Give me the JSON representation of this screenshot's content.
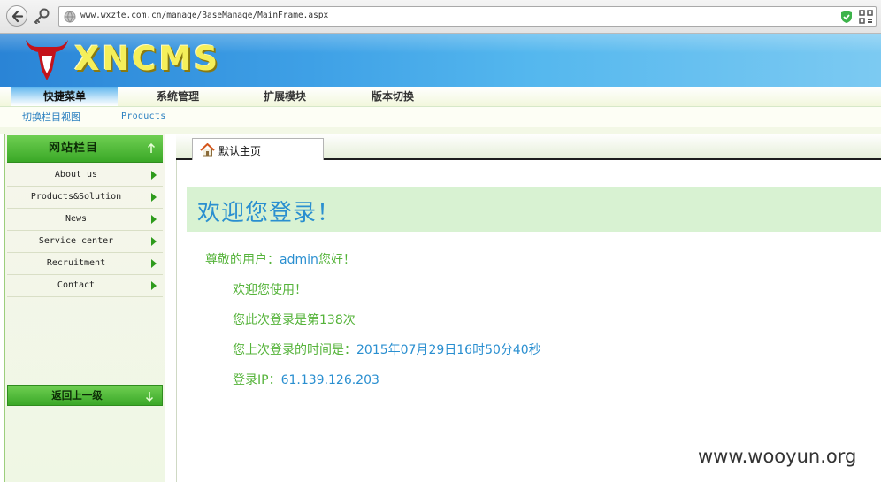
{
  "browser": {
    "url": "www.wxzte.com.cn/manage/BaseManage/MainFrame.aspx"
  },
  "header": {
    "logo_text": "XNCMS"
  },
  "menu": {
    "items": [
      {
        "label": "快捷菜单",
        "active": true
      },
      {
        "label": "系统管理",
        "active": false
      },
      {
        "label": "扩展模块",
        "active": false
      },
      {
        "label": "版本切换",
        "active": false
      }
    ],
    "sub_items": [
      "切换栏目视图",
      "Products"
    ]
  },
  "sidebar": {
    "title": "网站栏目",
    "items": [
      {
        "label": "About us"
      },
      {
        "label": "Products&Solution"
      },
      {
        "label": "News"
      },
      {
        "label": "Service center"
      },
      {
        "label": "Recruitment"
      },
      {
        "label": "Contact"
      }
    ],
    "back_label": "返回上一级"
  },
  "tab": {
    "label": "默认主页"
  },
  "content": {
    "welcome_title": "欢迎您登录！",
    "greeting_prefix": "尊敬的用户：",
    "username": "admin",
    "greeting_suffix": "您好！",
    "welcome_use": "欢迎您使用！",
    "login_count_prefix": "您此次登录是第",
    "login_count": "138",
    "login_count_suffix": "次",
    "last_login_label": "您上次登录的时间是：",
    "last_login_time": "2015年07月29日16时50分40秒",
    "ip_label": "登录IP：",
    "ip": "61.139.126.203"
  },
  "watermark": "www.wooyun.org",
  "colors": {
    "header_blue": "#3ea0e6",
    "sidebar_green": "#3aa827",
    "info_green": "#55b33a",
    "link_blue": "#2a8fd0",
    "welcome_band": "#d8f2d2"
  }
}
